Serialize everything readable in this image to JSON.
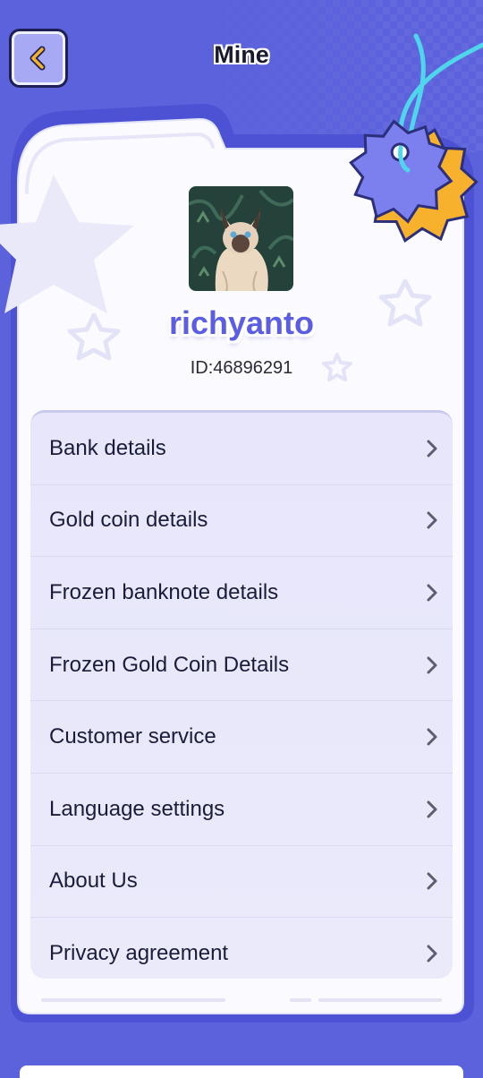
{
  "header": {
    "title": "Mine",
    "back_icon": "chevron-left-icon"
  },
  "profile": {
    "username": "richyanto",
    "user_id": "ID:46896291",
    "avatar": "siamese-cat-avatar"
  },
  "menu": {
    "items": [
      {
        "label": "Bank details"
      },
      {
        "label": "Gold coin details"
      },
      {
        "label": "Frozen banknote details"
      },
      {
        "label": "Frozen Gold Coin Details"
      },
      {
        "label": "Customer service"
      },
      {
        "label": "Language settings"
      },
      {
        "label": "About Us"
      },
      {
        "label": "Privacy agreement"
      }
    ],
    "item_icon": "chevron-right-icon"
  },
  "colors": {
    "background": "#5c62dc",
    "card": "#fafaff",
    "menu_panel": "#e9e8fb",
    "username": "#5b5ee3",
    "badge_primary": "#7c80ee",
    "badge_secondary": "#f7b12c",
    "string": "#4fd6ea"
  }
}
